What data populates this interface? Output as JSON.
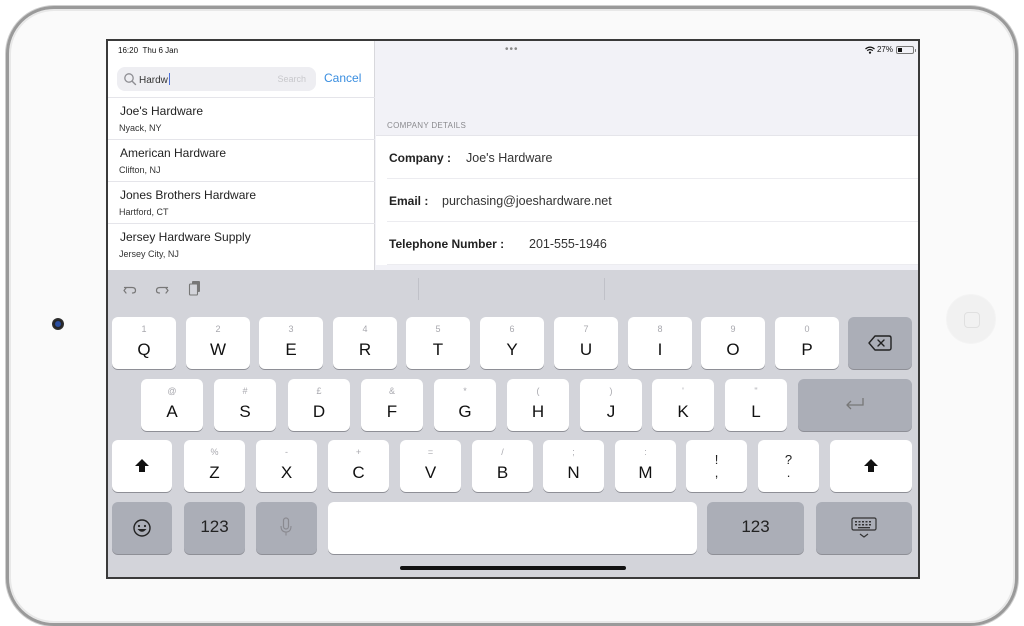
{
  "status_bar": {
    "time": "16:20",
    "date": "Thu 6 Jan",
    "multitask_dots": "•••",
    "battery_percent": "27%",
    "battery_level": 0.27
  },
  "search": {
    "value": "Hardw",
    "placeholder": "Search",
    "cancel_label": "Cancel"
  },
  "results": [
    {
      "name": "Joe's Hardware",
      "location": "Nyack, NY"
    },
    {
      "name": "American Hardware",
      "location": "Clifton, NJ"
    },
    {
      "name": "Jones Brothers Hardware",
      "location": "Hartford, CT"
    },
    {
      "name": "Jersey Hardware Supply",
      "location": "Jersey City, NJ"
    }
  ],
  "details": {
    "section_title": "COMPANY DETAILS",
    "rows": [
      {
        "label": "Company :",
        "value": "Joe's Hardware"
      },
      {
        "label": "Email :",
        "value": "purchasing@joeshardware.net"
      },
      {
        "label": "Telephone Number :",
        "value": "201-555-1946"
      }
    ]
  },
  "keyboard": {
    "toolbar": {
      "undo": "undo-icon",
      "redo": "redo-icon",
      "paste": "paste-icon"
    },
    "row1": [
      {
        "alt": "1",
        "main": "Q"
      },
      {
        "alt": "2",
        "main": "W"
      },
      {
        "alt": "3",
        "main": "E"
      },
      {
        "alt": "4",
        "main": "R"
      },
      {
        "alt": "5",
        "main": "T"
      },
      {
        "alt": "6",
        "main": "Y"
      },
      {
        "alt": "7",
        "main": "U"
      },
      {
        "alt": "8",
        "main": "I"
      },
      {
        "alt": "9",
        "main": "O"
      },
      {
        "alt": "0",
        "main": "P"
      }
    ],
    "row2": [
      {
        "alt": "@",
        "main": "A"
      },
      {
        "alt": "#",
        "main": "S"
      },
      {
        "alt": "£",
        "main": "D"
      },
      {
        "alt": "&",
        "main": "F"
      },
      {
        "alt": "*",
        "main": "G"
      },
      {
        "alt": "(",
        "main": "H"
      },
      {
        "alt": ")",
        "main": "J"
      },
      {
        "alt": "'",
        "main": "K"
      },
      {
        "alt": "\"",
        "main": "L"
      }
    ],
    "row3": [
      {
        "alt": "%",
        "main": "Z"
      },
      {
        "alt": "-",
        "main": "X"
      },
      {
        "alt": "+",
        "main": "C"
      },
      {
        "alt": "=",
        "main": "V"
      },
      {
        "alt": "/",
        "main": "B"
      },
      {
        "alt": ";",
        "main": "N"
      },
      {
        "alt": ":",
        "main": "M"
      },
      {
        "alt": "!",
        "main": ","
      },
      {
        "alt": "?",
        "main": "."
      }
    ],
    "numbers_label": "123",
    "numbers_label_right": "123"
  }
}
